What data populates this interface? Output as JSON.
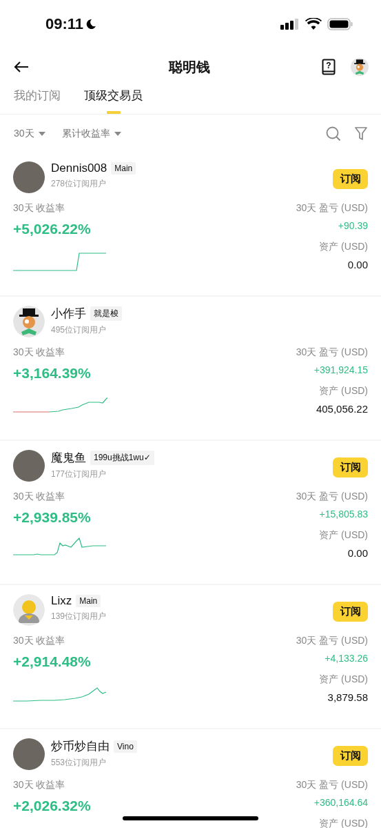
{
  "status_bar": {
    "time": "09:11"
  },
  "header": {
    "title": "聪明钱",
    "help_glyph": "?"
  },
  "tabs": [
    {
      "label": "我的订阅",
      "selected": false
    },
    {
      "label": "顶级交易员",
      "selected": true
    }
  ],
  "filters": [
    {
      "label": "30天"
    },
    {
      "label": "累计收益率"
    }
  ],
  "traders": [
    {
      "name": "Dennis008",
      "tag": "Main",
      "subscribers": "278位订阅用户",
      "kind": "photo",
      "subscribe": "订阅",
      "roi_label": "30天 收益率",
      "roi": "+5,026.22%",
      "pnl_label": "30天 盈亏 (USD)",
      "pnl": "+90.39",
      "assets_label": "资产 (USD)",
      "assets": "0.00"
    },
    {
      "name": "小作手",
      "tag": "就是梭",
      "subscribers": "495位订阅用户",
      "kind": "top-hat",
      "roi_label": "30天 收益率",
      "roi": "+3,164.39%",
      "pnl_label": "30天 盈亏 (USD)",
      "pnl": "+391,924.15",
      "assets_label": "资产 (USD)",
      "assets": "405,056.22"
    },
    {
      "name": "魔鬼鱼",
      "tag": "199u挑战1wu✓",
      "subscribers": "177位订阅用户",
      "kind": "photo",
      "subscribe": "订阅",
      "roi_label": "30天 收益率",
      "roi": "+2,939.85%",
      "pnl_label": "30天 盈亏 (USD)",
      "pnl": "+15,805.83",
      "assets_label": "资产 (USD)",
      "assets": "0.00"
    },
    {
      "name": "Lixz",
      "tag": "Main",
      "subscribers": "139位订阅用户",
      "kind": "silhouette",
      "subscribe": "订阅",
      "roi_label": "30天 收益率",
      "roi": "+2,914.48%",
      "pnl_label": "30天 盈亏 (USD)",
      "pnl": "+4,133.26",
      "assets_label": "资产 (USD)",
      "assets": "3,879.58"
    },
    {
      "name": "炒币炒自由",
      "tag": "Vino",
      "subscribers": "553位订阅用户",
      "kind": "photo",
      "subscribe": "订阅",
      "roi_label": "30天 收益率",
      "roi": "+2,026.32%",
      "pnl_label": "30天 盈亏 (USD)",
      "pnl": "+360,164.64",
      "assets_label": "资产 (USD)"
    }
  ]
}
